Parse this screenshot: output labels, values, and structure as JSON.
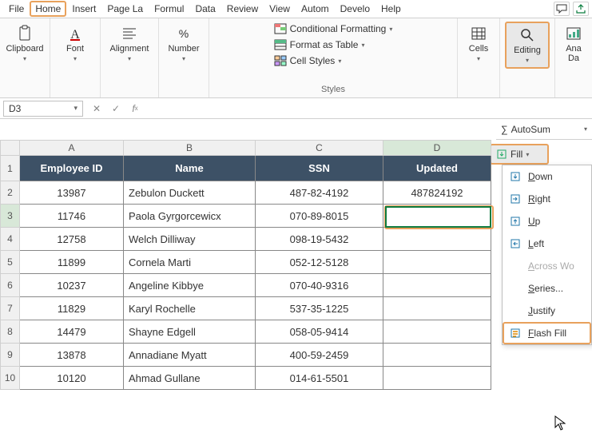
{
  "menu": {
    "items": [
      "File",
      "Home",
      "Insert",
      "Page La",
      "Formul",
      "Data",
      "Review",
      "View",
      "Autom",
      "Develo",
      "Help"
    ],
    "highlighted_index": 1
  },
  "ribbon": {
    "clipboard": {
      "label": "Clipboard"
    },
    "font": {
      "label": "Font"
    },
    "alignment": {
      "label": "Alignment"
    },
    "number": {
      "label": "Number"
    },
    "styles": {
      "label": "Styles",
      "cond_format": "Conditional Formatting",
      "format_table": "Format as Table",
      "cell_styles": "Cell Styles"
    },
    "cells": {
      "label": "Cells"
    },
    "editing": {
      "label": "Editing"
    },
    "analyze": {
      "label": "Ana",
      "label2": "Da"
    }
  },
  "name_box": "D3",
  "autosum": "AutoSum",
  "fill_btn": "Fill",
  "fill_menu": {
    "down": "Down",
    "right": "Right",
    "up": "Up",
    "left": "Left",
    "across": "Across Wo",
    "series": "Series...",
    "justify": "Justify",
    "flash": "Flash Fill"
  },
  "columns": [
    "A",
    "B",
    "C",
    "D"
  ],
  "headers": {
    "A": "Employee ID",
    "B": "Name",
    "C": "SSN",
    "D": "Updated"
  },
  "rows": [
    {
      "n": 1
    },
    {
      "n": 2,
      "A": "13987",
      "B": "Zebulon Duckett",
      "C": "487-82-4192",
      "D": "487824192"
    },
    {
      "n": 3,
      "A": "11746",
      "B": "Paola Gyrgorcewicx",
      "C": "070-89-8015",
      "D": ""
    },
    {
      "n": 4,
      "A": "12758",
      "B": "Welch Dilliway",
      "C": "098-19-5432",
      "D": ""
    },
    {
      "n": 5,
      "A": "11899",
      "B": "Cornela Marti",
      "C": "052-12-5128",
      "D": ""
    },
    {
      "n": 6,
      "A": "10237",
      "B": "Angeline Kibbye",
      "C": "070-40-9316",
      "D": ""
    },
    {
      "n": 7,
      "A": "11829",
      "B": "Karyl Rochelle",
      "C": "537-35-1225",
      "D": ""
    },
    {
      "n": 8,
      "A": "14479",
      "B": "Shayne Edgell",
      "C": "058-05-9414",
      "D": ""
    },
    {
      "n": 9,
      "A": "13878",
      "B": "Annadiane Myatt",
      "C": "400-59-2459",
      "D": ""
    },
    {
      "n": 10,
      "A": "10120",
      "B": "Ahmad Gullane",
      "C": "014-61-5501",
      "D": ""
    }
  ],
  "active_cell": "D3"
}
